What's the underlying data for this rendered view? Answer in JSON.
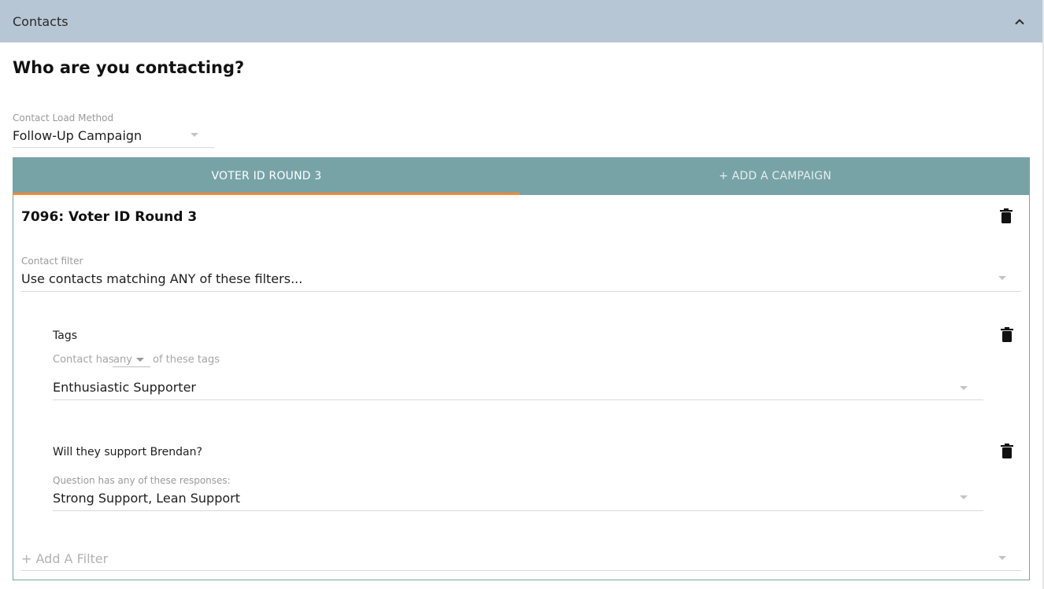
{
  "header": {
    "title": "Contacts"
  },
  "heading": "Who are you contacting?",
  "load_method": {
    "label": "Contact Load Method",
    "value": "Follow-Up Campaign"
  },
  "tabs": [
    {
      "label": "VOTER ID ROUND 3"
    },
    {
      "label": "+ ADD A CAMPAIGN"
    }
  ],
  "campaign": {
    "title": "7096: Voter ID Round 3",
    "contact_filter": {
      "label": "Contact filter",
      "value": "Use contacts matching ANY of these filters..."
    },
    "filters": [
      {
        "title": "Tags",
        "prefix": "Contact has",
        "mode": "any",
        "suffix": "of these tags",
        "value": "Enthusiastic Supporter"
      },
      {
        "title": "Will they support Brendan?",
        "label": "Question has any of these responses:",
        "value": "Strong Support, Lean Support"
      }
    ],
    "add_filter": "+ Add A Filter"
  },
  "colors": {
    "header_bg": "#b7c6d4",
    "tab_bg": "#77a3a7",
    "tab_indicator": "#f28b35"
  },
  "icons": [
    "chevron-up-icon",
    "trash-icon",
    "dropdown-caret-icon"
  ]
}
